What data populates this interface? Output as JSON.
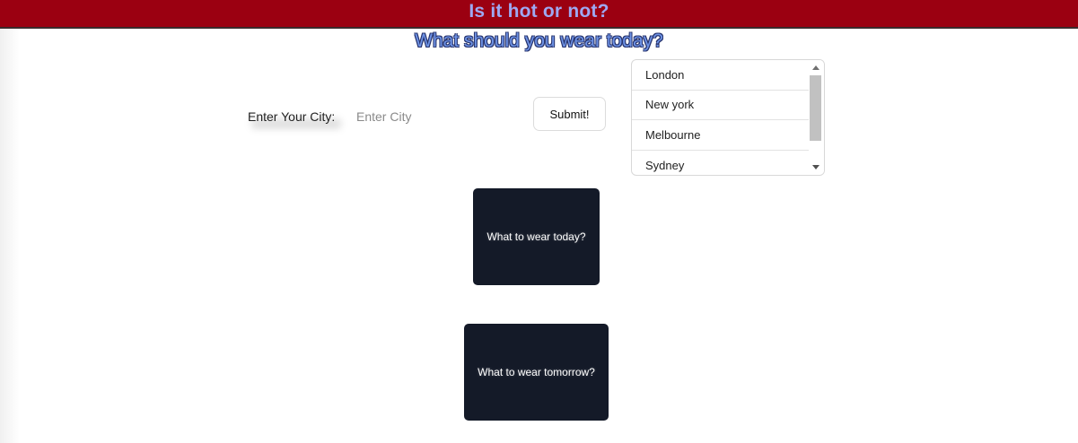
{
  "header": {
    "title": "Is it hot or not?",
    "subtitle": "What should you wear today?"
  },
  "form": {
    "city_label": "Enter Your City:",
    "city_placeholder": "Enter City",
    "city_value": "",
    "submit_label": "Submit!"
  },
  "city_list": {
    "items": [
      "London",
      "New york",
      "Melbourne",
      "Sydney"
    ]
  },
  "cards": {
    "today_label": "What to wear today?",
    "tomorrow_label": "What to wear tomorrow?"
  },
  "colors": {
    "banner_bg": "#9b0011",
    "banner_text": "#9ea8f2",
    "subtitle_text": "#6e93e6",
    "card_bg": "#141a28"
  }
}
